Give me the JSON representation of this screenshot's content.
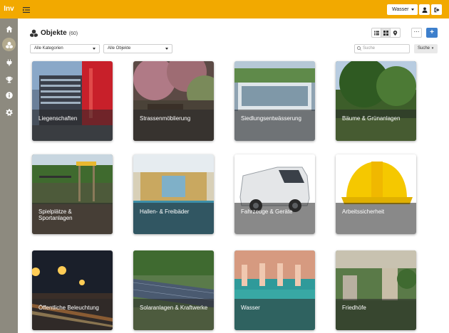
{
  "app": {
    "logo": "Inv"
  },
  "sidebar": {
    "items": [
      {
        "name": "home",
        "icon": "home-icon",
        "active": false
      },
      {
        "name": "objects",
        "icon": "objects-icon",
        "active": true
      },
      {
        "name": "tools",
        "icon": "plug-icon",
        "active": false
      },
      {
        "name": "awards",
        "icon": "trophy-icon",
        "active": false
      },
      {
        "name": "info",
        "icon": "info-icon",
        "active": false
      },
      {
        "name": "settings",
        "icon": "gear-icon",
        "active": false
      }
    ]
  },
  "topbar": {
    "selected_domain": "Wasser"
  },
  "page": {
    "title": "Objekte",
    "count": "(60)"
  },
  "filters": {
    "category": "Alle Kategorien",
    "objects": "Alle Objekte",
    "search_placeholder": "Suche",
    "search_button": "Suche"
  },
  "tiles": [
    {
      "label": "Liegenschaften"
    },
    {
      "label": "Strassenmöblierung"
    },
    {
      "label": "Siedlungsentwässerung"
    },
    {
      "label": "Bäume & Grünanlagen"
    },
    {
      "label": "Spielplätze & Sportanlagen"
    },
    {
      "label": "Hallen- & Freibäder"
    },
    {
      "label": "Fahrzeuge & Geräte"
    },
    {
      "label": "Arbeitssicherheit"
    },
    {
      "label": "Öffentliche Beleuchtung"
    },
    {
      "label": "Solaranlagen & Kraftwerke"
    },
    {
      "label": "Wasser"
    },
    {
      "label": "Friedhöfe"
    }
  ],
  "colors": {
    "accent": "#f2a900",
    "sidebar": "#8d8a7f",
    "primary": "#3d7fcc"
  }
}
